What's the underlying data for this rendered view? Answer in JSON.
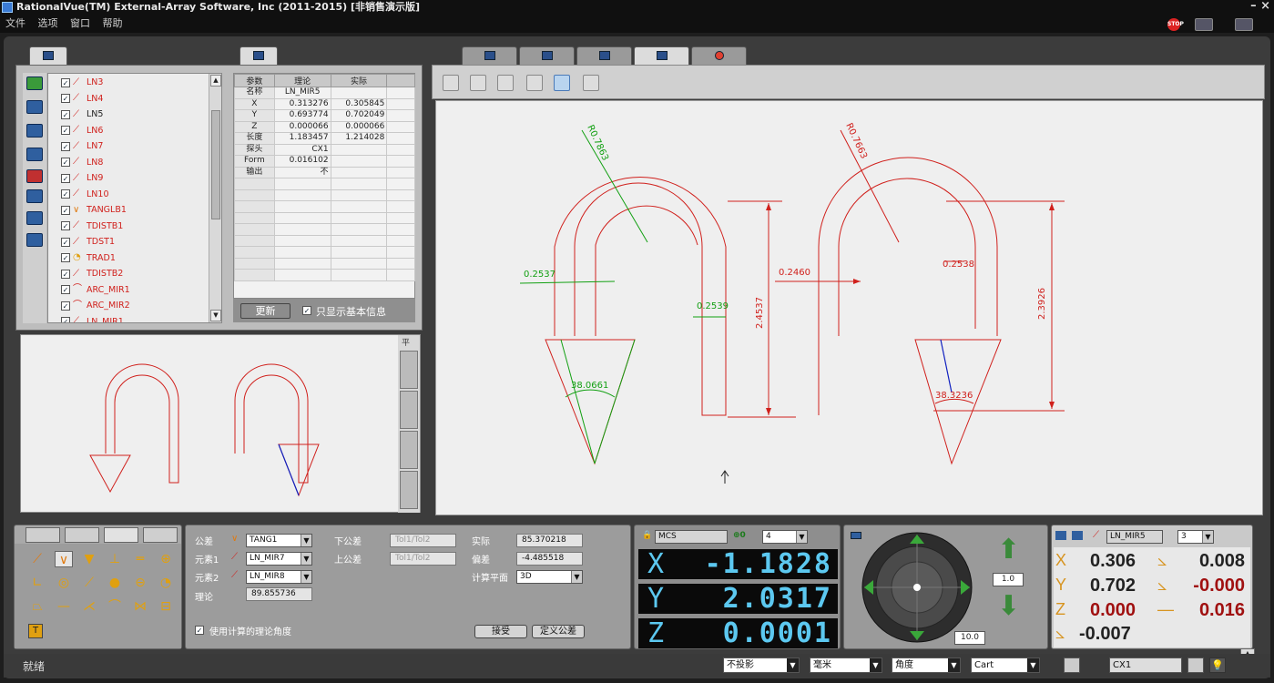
{
  "window": {
    "title": "RationalVue(TM) External-Array Software, Inc (2011-2015) [非销售演示版]",
    "controls": "– ×"
  },
  "menu": [
    "文件",
    "选项",
    "窗口",
    "帮助"
  ],
  "features": [
    {
      "name": "LN3",
      "icon": "line-icon",
      "color": "red"
    },
    {
      "name": "LN4",
      "icon": "line-icon",
      "color": "red"
    },
    {
      "name": "LN5",
      "icon": "line-icon",
      "color": "black"
    },
    {
      "name": "LN6",
      "icon": "line-icon",
      "color": "red"
    },
    {
      "name": "LN7",
      "icon": "line-icon",
      "color": "red"
    },
    {
      "name": "LN8",
      "icon": "line-icon",
      "color": "red"
    },
    {
      "name": "LN9",
      "icon": "line-icon",
      "color": "red"
    },
    {
      "name": "LN10",
      "icon": "line-icon",
      "color": "red"
    },
    {
      "name": "TANGLB1",
      "icon": "angle-icon",
      "color": "red"
    },
    {
      "name": "TDISTB1",
      "icon": "distance-icon",
      "color": "red"
    },
    {
      "name": "TDST1",
      "icon": "distance-icon",
      "color": "red"
    },
    {
      "name": "TRAD1",
      "icon": "radius-icon",
      "color": "red"
    },
    {
      "name": "TDISTB2",
      "icon": "distance-icon",
      "color": "red"
    },
    {
      "name": "ARC_MIR1",
      "icon": "arc-icon",
      "color": "red"
    },
    {
      "name": "ARC_MIR2",
      "icon": "arc-icon",
      "color": "red"
    },
    {
      "name": "LN_MIR1",
      "icon": "line-icon",
      "color": "red"
    }
  ],
  "params": {
    "headers": [
      "参数",
      "理论",
      "实际"
    ],
    "rows": [
      [
        "名称",
        "LN_MIR5",
        ""
      ],
      [
        "X",
        "0.313276",
        "0.305845"
      ],
      [
        "Y",
        "0.693774",
        "0.702049"
      ],
      [
        "Z",
        "0.000066",
        "0.000066"
      ],
      [
        "长度",
        "1.183457",
        "1.214028"
      ],
      [
        "探头",
        "CX1",
        ""
      ],
      [
        "Form",
        "0.016102",
        ""
      ],
      [
        "输出",
        "不",
        ""
      ]
    ],
    "update_button": "更新",
    "basic_only_label": "只显示基本信息"
  },
  "graphics": {
    "dims": {
      "r_left": "R0.7863",
      "r_right": "R0.7663",
      "left_width": "0.2537",
      "left_inner": "0.2539",
      "left_height": "2.4537",
      "left_angle": "38.0661",
      "right_width": "0.2460",
      "right_inner": "0.2538",
      "right_height": "2.3926",
      "right_angle": "38.3236"
    },
    "mini_tool_label": "平"
  },
  "construct": {
    "tolerance_label": "公差",
    "tolerance_value": "TANG1",
    "element1_label": "元素1",
    "element1_value": "LN_MIR7",
    "element2_label": "元素2",
    "element2_value": "LN_MIR8",
    "theory_label": "理论",
    "theory_value": "89.855736",
    "lower_tol_label": "下公差",
    "lower_tol_value": "Tol1/Tol2",
    "upper_tol_label": "上公差",
    "upper_tol_value": "Tol1/Tol2",
    "actual_label": "实际",
    "actual_value": "85.370218",
    "deviation_label": "偏差",
    "deviation_value": "-4.485518",
    "plane_label": "计算平面",
    "plane_value": "3D",
    "use_theory_label": "使用计算的理论角度",
    "accept_button": "接受",
    "define_tol_button": "定义公差"
  },
  "dro": {
    "coord_system": "MCS",
    "zero_label": "0",
    "decimals": "4",
    "x": "-1.1828",
    "y": "2.0317",
    "z": "0.0001",
    "x_axis": "X",
    "y_axis": "Y",
    "z_axis": "Z"
  },
  "joystick": {
    "speed": "1.0",
    "step": "10.0"
  },
  "results": {
    "feature": "LN_MIR5",
    "count": "3",
    "x": "0.306",
    "y": "0.702",
    "z": "0.000",
    "angle_xy": "0.008",
    "angle_yz": "-0.000",
    "straightness": "0.016",
    "angle_zx": "-0.007"
  },
  "status": {
    "ready": "就绪",
    "projection": "不投影",
    "unit": "毫米",
    "angle_unit": "角度",
    "coord_type": "Cart",
    "probe": "CX1"
  },
  "colors": {
    "accent_blue": "#2f5f9f",
    "dim_red": "#d0201c",
    "dim_green": "#12a012",
    "dro_text": "#5cc8f0"
  }
}
